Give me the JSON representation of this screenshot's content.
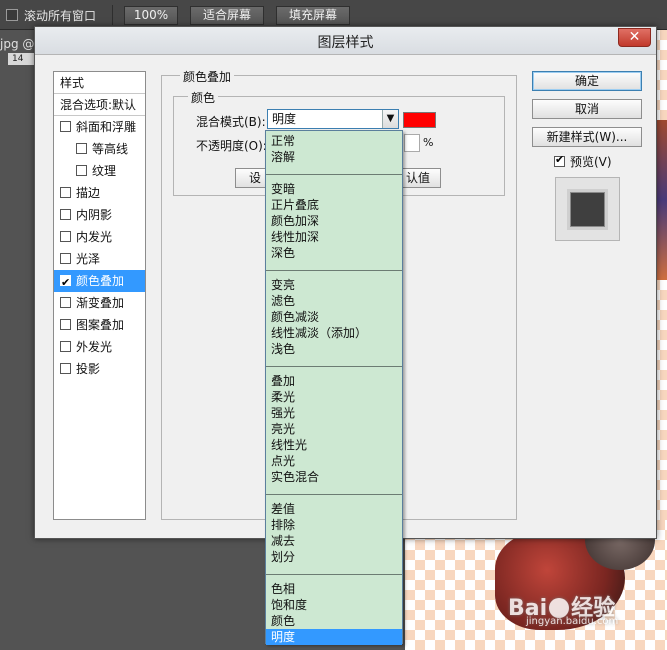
{
  "options_bar": {
    "scroll_all_label": "滚动所有窗口",
    "zoom_100": "100%",
    "fit_screen": "适合屏幕",
    "fill_screen": "填充屏幕",
    "doc_tab": "jpg @",
    "ruler_value": "14"
  },
  "dialog": {
    "title": "图层样式",
    "close": "✕",
    "styles_panel": {
      "header": "样式",
      "blend_options": "混合选项:默认",
      "items": [
        {
          "label": "斜面和浮雕",
          "checked": false,
          "sub": false
        },
        {
          "label": "等高线",
          "checked": false,
          "sub": true
        },
        {
          "label": "纹理",
          "checked": false,
          "sub": true
        },
        {
          "label": "描边",
          "checked": false,
          "sub": false
        },
        {
          "label": "内阴影",
          "checked": false,
          "sub": false
        },
        {
          "label": "内发光",
          "checked": false,
          "sub": false
        },
        {
          "label": "光泽",
          "checked": false,
          "sub": false
        },
        {
          "label": "颜色叠加",
          "checked": true,
          "sub": false
        },
        {
          "label": "渐变叠加",
          "checked": false,
          "sub": false
        },
        {
          "label": "图案叠加",
          "checked": false,
          "sub": false
        },
        {
          "label": "外发光",
          "checked": false,
          "sub": false
        },
        {
          "label": "投影",
          "checked": false,
          "sub": false
        }
      ]
    },
    "color_overlay": {
      "group_title": "颜色叠加",
      "subgroup_title": "颜色",
      "blend_mode_label": "混合模式(B):",
      "blend_mode_value": "明度",
      "opacity_label": "不透明度(O):",
      "opacity_unit": "%",
      "overlay_color": "#ff0000",
      "set_default_btn": "设",
      "reset_default_btn": "认值"
    },
    "buttons": {
      "ok": "确定",
      "cancel": "取消",
      "new_style": "新建样式(W)...",
      "preview_label": "预览(V)",
      "preview_checked": true
    },
    "blend_modes": [
      [
        "正常",
        "溶解"
      ],
      [
        "变暗",
        "正片叠底",
        "颜色加深",
        "线性加深",
        "深色"
      ],
      [
        "变亮",
        "滤色",
        "颜色减淡",
        "线性减淡（添加）",
        "浅色"
      ],
      [
        "叠加",
        "柔光",
        "强光",
        "亮光",
        "线性光",
        "点光",
        "实色混合"
      ],
      [
        "差值",
        "排除",
        "减去",
        "划分"
      ],
      [
        "色相",
        "饱和度",
        "颜色",
        "明度"
      ]
    ],
    "selected_blend_mode": "明度"
  },
  "watermark": {
    "brand_left": "Bai",
    "brand_right": "经验",
    "url": "jingyan.baidu.com"
  }
}
